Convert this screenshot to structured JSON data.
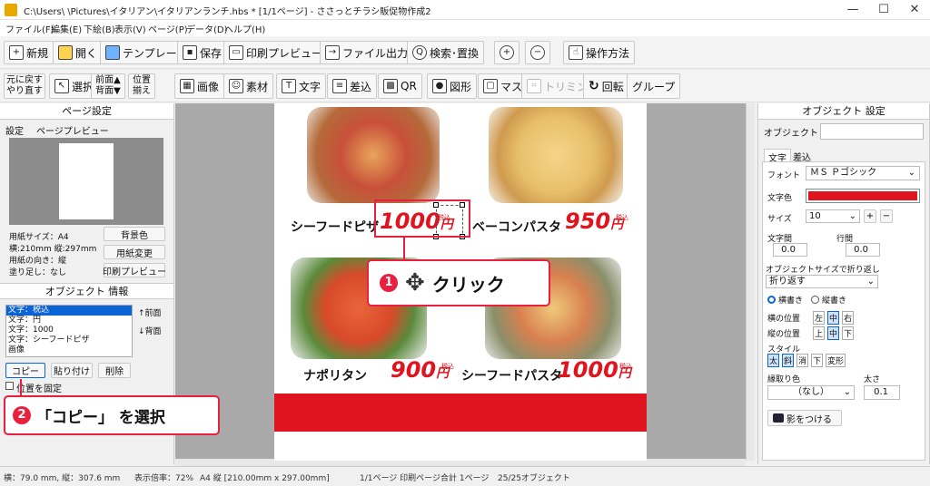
{
  "window": {
    "title": "C:\\Users\\            \\Pictures\\イタリアン\\イタリアンランチ.hbs * [1/1ページ] - ささっとチラシ販促物作成2",
    "minimize": "—",
    "maximize": "☐",
    "close": "✕"
  },
  "menu": [
    "ファイル(F)",
    "編集(E)",
    "下絵(B)",
    "表示(V)",
    "ページ(P)",
    "データ(D)",
    "ヘルプ(H)"
  ],
  "toolbar1": {
    "new": "新規",
    "open": "開く",
    "template": "テンプレート",
    "save": "保存",
    "print_preview": "印刷プレビュー",
    "file_output": "ファイル出力",
    "search_replace": "検索･置換",
    "zoom_in": "+",
    "zoom_out": "−",
    "howto": "操作方法"
  },
  "toolbar2": {
    "undo": "元に戻す",
    "redo": "やり直す",
    "select": "選択",
    "front": "前面▲",
    "back": "背面▼",
    "align1": "位置",
    "align2": "揃え",
    "image": "画像",
    "material": "素材",
    "text": "文字",
    "merge": "差込",
    "qr": "QR",
    "shape": "図形",
    "mask": "マスク",
    "trim": "トリミング",
    "rotate": "回転",
    "group": "グループ"
  },
  "page_settings": {
    "header": "ページ設定",
    "tabs": [
      "設定",
      "ページプレビュー"
    ],
    "paper_size": "用紙サイズ：A4",
    "dimensions": "横:210mm 縦:297mm",
    "orientation": "用紙の向き：縦",
    "bleed": "塗り足し：なし",
    "bg_color_btn": "背景色",
    "paper_change_btn": "用紙変更",
    "print_preview_btn": "印刷プレビュー"
  },
  "object_info": {
    "header": "オブジェクト 情報",
    "items": [
      "文字：税込",
      "文字：円",
      "文字：1000",
      "文字：シーフードピザ",
      "画像"
    ],
    "front_btn": "↑前面",
    "back_btn": "↓背面",
    "copy_btn": "コピー",
    "paste_btn": "貼り付け",
    "delete_btn": "削除",
    "fix_pos": "位置を固定"
  },
  "menu_items": {
    "item1": {
      "name": "シーフードピザ",
      "price": "1000",
      "yen": "円",
      "tax": "税込"
    },
    "item2": {
      "name": "ベーコンパスタ",
      "price": "950",
      "yen": "円",
      "tax": "税込"
    },
    "item3": {
      "name": "ナポリタン",
      "price": "900",
      "yen": "円",
      "tax": "税込"
    },
    "item4": {
      "name": "シーフードパスタ",
      "price": "1000",
      "yen": "円",
      "tax": "税込"
    }
  },
  "callouts": {
    "click_num": "1",
    "click_text": "クリック",
    "copy_num": "2",
    "copy_text": "「コピー」 を選択"
  },
  "object_settings": {
    "header": "オブジェクト 設定",
    "name_label": "オブジェクト 名",
    "name_value": "",
    "tabs": [
      "文字",
      "差込"
    ],
    "font_label": "フォント",
    "font_value": "ＭＳ Ｐゴシック",
    "color_label": "文字色",
    "text_color": "#e0141e",
    "size_label": "サイズ",
    "size_value": "10",
    "plus": "+",
    "minus": "−",
    "char_spacing_label": "文字間",
    "char_spacing_value": "0.0",
    "line_spacing_label": "行間",
    "line_spacing_value": "0.0",
    "wrap_label": "オブジェクトサイズで折り返し",
    "wrap_value": "折り返す",
    "horizontal": "横書き",
    "vertical": "縦書き",
    "h_pos_label": "横の位置",
    "h_pos": [
      "左",
      "中",
      "右"
    ],
    "v_pos_label": "縦の位置",
    "v_pos": [
      "上",
      "中",
      "下"
    ],
    "style_label": "スタイル",
    "styles": [
      "太",
      "斜",
      "消",
      "下",
      "変形"
    ],
    "outline_color_label": "縁取り色",
    "outline_color_value": "（なし）",
    "thickness_label": "太さ",
    "thickness_value": "0.1",
    "shadow_btn": "影をつける"
  },
  "status": {
    "position": "横：79.0 mm, 縦：307.6 mm",
    "zoom": "表示倍率：72%",
    "paper": "A4 縦 [210.00mm x 297.00mm]",
    "pages": "1/1ページ 印刷ページ合計 1ページ",
    "objects": "25/25オブジェクト"
  },
  "colors": {
    "accent_red": "#e0141e",
    "callout_red": "#e8203e",
    "selection_blue": "#0a64d6"
  }
}
